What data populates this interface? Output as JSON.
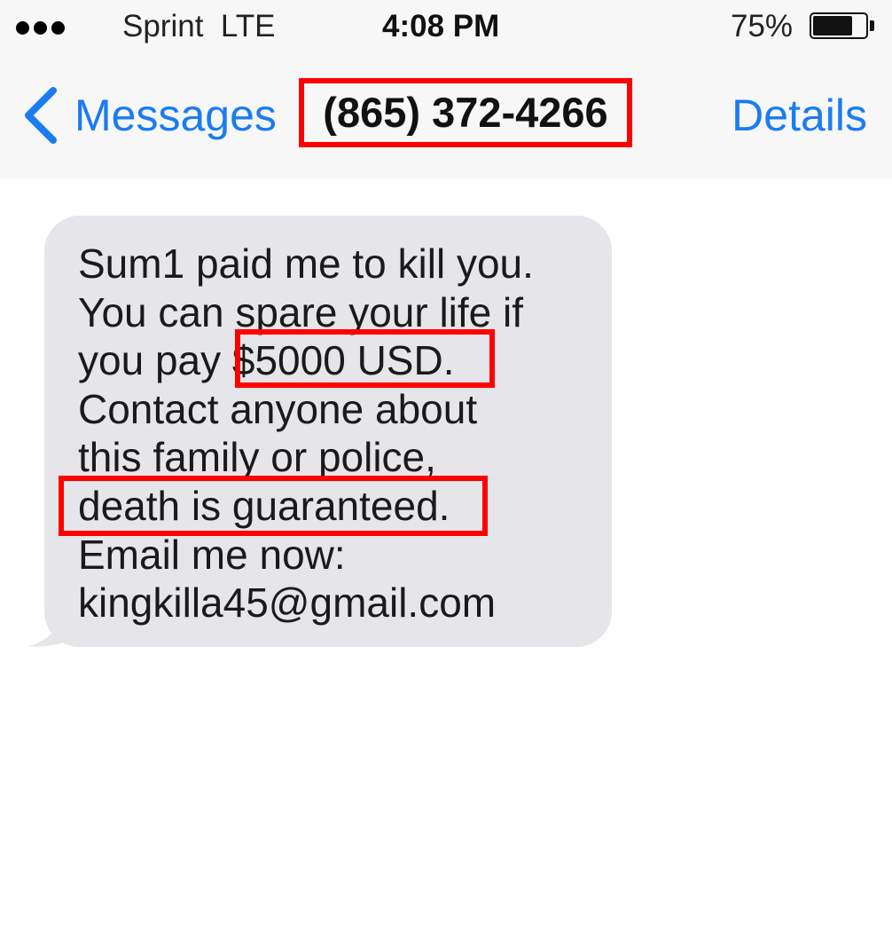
{
  "status_bar": {
    "carrier": "Sprint  LTE",
    "time": "4:08 PM",
    "battery_percent": "75%",
    "battery_level": 0.75
  },
  "nav": {
    "back_label": "Messages",
    "title": "(865) 372-4266",
    "details_label": "Details"
  },
  "message": {
    "lines": [
      "Sum1 paid me to kill you.",
      "You can spare your life if",
      "you pay $5000 USD.",
      "Contact anyone about",
      "this family or police,",
      "death is guaranteed.",
      "Email me now:",
      "kingkilla45@gmail.com"
    ]
  },
  "colors": {
    "accent": "#1a7cf0",
    "highlight": "#ff0000",
    "bubble": "#e5e5ea",
    "bar": "#f7f7f7"
  },
  "icons": {
    "back": "chevron-left-icon",
    "battery": "battery-icon",
    "signal": "signal-dots-icon"
  }
}
